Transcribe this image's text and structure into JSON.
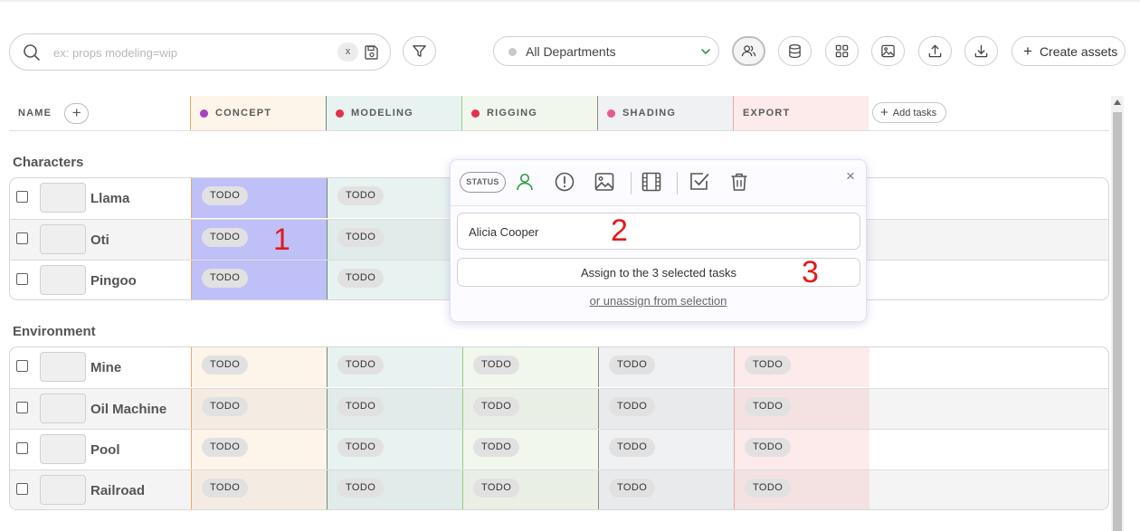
{
  "toolbar": {
    "search_placeholder": "ex: props modeling=wip",
    "search_value": "",
    "clear_label": "x",
    "department_label": "All Departments",
    "create_label": "Create assets",
    "create_plus": "+"
  },
  "header": {
    "name_label": "NAME",
    "add_plus": "+",
    "add_tasks_label": "Add tasks",
    "columns": [
      {
        "label": "CONCEPT",
        "color": "#a83fc2"
      },
      {
        "label": "MODELING",
        "color": "#e0334a"
      },
      {
        "label": "RIGGING",
        "color": "#e0334a"
      },
      {
        "label": "SHADING",
        "color": "#e85a8f"
      },
      {
        "label": "EXPORT",
        "color": ""
      }
    ]
  },
  "sections": [
    {
      "title": "Characters",
      "rows": [
        {
          "name": "Llama",
          "tasks": [
            "TODO",
            "TODO",
            "",
            "",
            ""
          ],
          "concept_selected": true
        },
        {
          "name": "Oti",
          "tasks": [
            "TODO",
            "TODO",
            "",
            "",
            ""
          ],
          "concept_selected": true
        },
        {
          "name": "Pingoo",
          "tasks": [
            "TODO",
            "TODO",
            "",
            "",
            ""
          ],
          "concept_selected": true
        }
      ]
    },
    {
      "title": "Environment",
      "rows": [
        {
          "name": "Mine",
          "tasks": [
            "TODO",
            "TODO",
            "TODO",
            "TODO",
            "TODO"
          ]
        },
        {
          "name": "Oil Machine",
          "tasks": [
            "TODO",
            "TODO",
            "TODO",
            "TODO",
            "TODO"
          ]
        },
        {
          "name": "Pool",
          "tasks": [
            "TODO",
            "TODO",
            "TODO",
            "TODO",
            "TODO"
          ]
        },
        {
          "name": "Railroad",
          "tasks": [
            "TODO",
            "TODO",
            "TODO",
            "TODO",
            "TODO"
          ]
        }
      ]
    }
  ],
  "popup": {
    "status_label": "STATUS",
    "close_label": "×",
    "person_value": "Alicia Cooper",
    "assign_label": "Assign to the 3 selected tasks",
    "unassign_label": "or unassign from selection"
  },
  "markers": [
    "1",
    "2",
    "3"
  ],
  "colors": {
    "selection": "#bfc0f7",
    "person_icon": "#3aa14a",
    "marker": "#e01b1b"
  }
}
